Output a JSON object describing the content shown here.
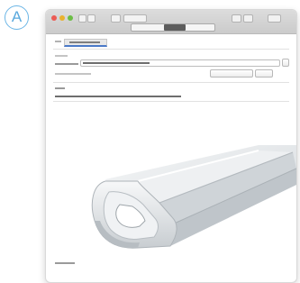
{
  "annotation": {
    "marker_letter": "A",
    "marker_color": "#5aa9dd"
  },
  "window": {
    "traffic_lights": [
      "close",
      "minimize",
      "zoom"
    ],
    "traffic_colors": [
      "#ec5b54",
      "#e9b22f",
      "#6bbd45"
    ],
    "toolbar_icons": [
      "back-icon",
      "forward-icon",
      "share-icon",
      "action-icon",
      "sidebar-icon",
      "search-icon"
    ],
    "segmented_selected_index": 1
  },
  "tabs": {
    "active_accent": "#4a79c8"
  },
  "illustration": {
    "subject": "aluminum-profile-icon",
    "colors": {
      "body": "#e3e6e8",
      "shadow": "#b9bec2",
      "edge": "#f7f8f9"
    }
  }
}
